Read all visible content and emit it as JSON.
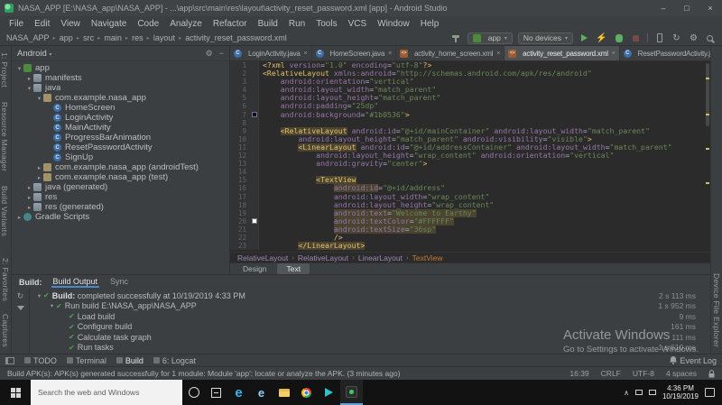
{
  "window": {
    "title": "NASA_APP [E:\\NASA_app\\NASA_APP] - ...\\app\\src\\main\\res\\layout\\activity_reset_password.xml [app] - Android Studio",
    "controls": {
      "minimize": "–",
      "maximize": "□",
      "close": "×"
    }
  },
  "menu": {
    "items": [
      "File",
      "Edit",
      "View",
      "Navigate",
      "Code",
      "Analyze",
      "Refactor",
      "Build",
      "Run",
      "Tools",
      "VCS",
      "Window",
      "Help"
    ]
  },
  "toolbar": {
    "path": [
      "NASA_APP",
      "app",
      "src",
      "main",
      "res",
      "layout",
      "activity_reset_password.xml"
    ],
    "run_config": "app",
    "device": "No devices"
  },
  "stripes": {
    "left_top": [
      "1: Project",
      "Resource Manager",
      "Build Variants"
    ],
    "left_bottom": [
      "2: Favorites",
      "Captures"
    ],
    "right_bottom": [
      "Device File Explorer"
    ]
  },
  "project": {
    "header": "Android",
    "tree": [
      {
        "label": "app",
        "depth": 0,
        "icon": "app",
        "arrow": "▾"
      },
      {
        "label": "manifests",
        "depth": 1,
        "icon": "folder",
        "arrow": "▸"
      },
      {
        "label": "java",
        "depth": 1,
        "icon": "folder",
        "arrow": "▾"
      },
      {
        "label": "com.example.nasa_app",
        "depth": 2,
        "icon": "package",
        "arrow": "▾"
      },
      {
        "label": "HomeScreen",
        "depth": 3,
        "icon": "class",
        "arrow": ""
      },
      {
        "label": "LoginActivity",
        "depth": 3,
        "icon": "class",
        "arrow": ""
      },
      {
        "label": "MainActivity",
        "depth": 3,
        "icon": "class",
        "arrow": ""
      },
      {
        "label": "ProgressBarAnimation",
        "depth": 3,
        "icon": "class",
        "arrow": ""
      },
      {
        "label": "ResetPasswordActivity",
        "depth": 3,
        "icon": "class",
        "arrow": ""
      },
      {
        "label": "SignUp",
        "depth": 3,
        "icon": "class",
        "arrow": ""
      },
      {
        "label": "com.example.nasa_app (androidTest)",
        "depth": 2,
        "icon": "package",
        "arrow": "▸"
      },
      {
        "label": "com.example.nasa_app (test)",
        "depth": 2,
        "icon": "package",
        "arrow": "▸"
      },
      {
        "label": "java (generated)",
        "depth": 1,
        "icon": "folder",
        "arrow": "▸"
      },
      {
        "label": "res",
        "depth": 1,
        "icon": "folder",
        "arrow": "▸"
      },
      {
        "label": "res (generated)",
        "depth": 1,
        "icon": "folder",
        "arrow": "▸"
      },
      {
        "label": "Gradle Scripts",
        "depth": 0,
        "icon": "gradle",
        "arrow": "▸"
      }
    ]
  },
  "editor": {
    "tabs": [
      {
        "label": "LoginActivity.java",
        "icon": "java",
        "selected": false
      },
      {
        "label": "HomeScreen.java",
        "icon": "java",
        "selected": false
      },
      {
        "label": "activity_home_screen.xml",
        "icon": "xml",
        "selected": false
      },
      {
        "label": "activity_reset_password.xml",
        "icon": "xml",
        "selected": true
      },
      {
        "label": "ResetPasswordActivity.java",
        "icon": "java",
        "selected": false
      }
    ],
    "breadcrumb": [
      "RelativeLayout",
      "RelativeLayout",
      "LinearLayout",
      "TextView"
    ],
    "view_tabs": [
      {
        "label": "Design",
        "selected": false
      },
      {
        "label": "Text",
        "selected": true
      }
    ],
    "code": [
      {
        "n": 1,
        "s": [
          [
            "<?xml ",
            "t"
          ],
          [
            "version",
            "a"
          ],
          [
            "=",
            "p"
          ],
          [
            "\"1.0\"",
            "v"
          ],
          [
            " ",
            "p"
          ],
          [
            "encoding",
            "a"
          ],
          [
            "=",
            "p"
          ],
          [
            "\"utf-8\"",
            "v"
          ],
          [
            "?>",
            "t"
          ]
        ]
      },
      {
        "n": 2,
        "s": [
          [
            "<RelativeLayout ",
            "t"
          ],
          [
            "xmlns:android",
            "a"
          ],
          [
            "=",
            "p"
          ],
          [
            "\"http://schemas.android.com/apk/res/android\"",
            "v"
          ]
        ]
      },
      {
        "n": 3,
        "s": [
          [
            "    ",
            "p"
          ],
          [
            "android:orientation",
            "a"
          ],
          [
            "=",
            "p"
          ],
          [
            "\"vertical\"",
            "v"
          ]
        ]
      },
      {
        "n": 4,
        "s": [
          [
            "    ",
            "p"
          ],
          [
            "android:layout_width",
            "a"
          ],
          [
            "=",
            "p"
          ],
          [
            "\"match_parent\"",
            "v"
          ]
        ]
      },
      {
        "n": 5,
        "s": [
          [
            "    ",
            "p"
          ],
          [
            "android:layout_height",
            "a"
          ],
          [
            "=",
            "p"
          ],
          [
            "\"match_parent\"",
            "v"
          ]
        ]
      },
      {
        "n": 6,
        "s": [
          [
            "    ",
            "p"
          ],
          [
            "android:padding",
            "a"
          ],
          [
            "=",
            "p"
          ],
          [
            "\"25dp\"",
            "v"
          ]
        ]
      },
      {
        "n": 7,
        "sw": "#1b0536",
        "s": [
          [
            "    ",
            "p"
          ],
          [
            "android:background",
            "a"
          ],
          [
            "=",
            "p"
          ],
          [
            "\"#1b0536\"",
            "v"
          ],
          [
            ">",
            "t"
          ]
        ]
      },
      {
        "n": 8,
        "s": []
      },
      {
        "n": 9,
        "s": [
          [
            "    ",
            "p"
          ],
          [
            "<RelativeLayout",
            "t",
            1
          ],
          [
            " ",
            "p"
          ],
          [
            "android:id",
            "a"
          ],
          [
            "=",
            "p"
          ],
          [
            "\"@+id/mainContainer\"",
            "v"
          ],
          [
            " ",
            "p"
          ],
          [
            "android:layout_width",
            "a"
          ],
          [
            "=",
            "p"
          ],
          [
            "\"match_parent\"",
            "v"
          ]
        ]
      },
      {
        "n": 10,
        "s": [
          [
            "        ",
            "p"
          ],
          [
            "android:layout_height",
            "a"
          ],
          [
            "=",
            "p"
          ],
          [
            "\"match_parent\"",
            "v"
          ],
          [
            " ",
            "p"
          ],
          [
            "android:visibility",
            "a"
          ],
          [
            "=",
            "p"
          ],
          [
            "\"visible\"",
            "v"
          ],
          [
            ">",
            "t"
          ]
        ]
      },
      {
        "n": 11,
        "s": [
          [
            "        ",
            "p"
          ],
          [
            "<LinearLayout",
            "t",
            1
          ],
          [
            " ",
            "p"
          ],
          [
            "android:id",
            "a"
          ],
          [
            "=",
            "p"
          ],
          [
            "\"@+id/addressContainer\"",
            "v"
          ],
          [
            " ",
            "p"
          ],
          [
            "android:layout_width",
            "a"
          ],
          [
            "=",
            "p"
          ],
          [
            "\"match_parent\"",
            "v"
          ]
        ]
      },
      {
        "n": 12,
        "s": [
          [
            "            ",
            "p"
          ],
          [
            "android:layout_height",
            "a"
          ],
          [
            "=",
            "p"
          ],
          [
            "\"wrap_content\"",
            "v"
          ],
          [
            " ",
            "p"
          ],
          [
            "android:orientation",
            "a"
          ],
          [
            "=",
            "p"
          ],
          [
            "\"vertical\"",
            "v"
          ]
        ]
      },
      {
        "n": 13,
        "s": [
          [
            "            ",
            "p"
          ],
          [
            "android:gravity",
            "a"
          ],
          [
            "=",
            "p"
          ],
          [
            "\"center\"",
            "v"
          ],
          [
            ">",
            "t"
          ]
        ]
      },
      {
        "n": 14,
        "s": []
      },
      {
        "n": 15,
        "s": [
          [
            "            ",
            "p"
          ],
          [
            "<TextView",
            "t",
            1
          ]
        ]
      },
      {
        "n": 16,
        "s": [
          [
            "                ",
            "p"
          ],
          [
            "android:id",
            "a",
            1
          ],
          [
            "=",
            "p"
          ],
          [
            "\"@+id/address\"",
            "v"
          ]
        ]
      },
      {
        "n": 17,
        "s": [
          [
            "                ",
            "p"
          ],
          [
            "android:layout_width",
            "a"
          ],
          [
            "=",
            "p"
          ],
          [
            "\"wrap_content\"",
            "v"
          ]
        ]
      },
      {
        "n": 18,
        "s": [
          [
            "                ",
            "p"
          ],
          [
            "android:layout_height",
            "a"
          ],
          [
            "=",
            "p"
          ],
          [
            "\"wrap_content\"",
            "v"
          ]
        ]
      },
      {
        "n": 19,
        "s": [
          [
            "                ",
            "p"
          ],
          [
            "android:text",
            "a",
            1
          ],
          [
            "=",
            "p",
            1
          ],
          [
            "\"Welcome to Earthy\"",
            "v",
            1
          ]
        ]
      },
      {
        "n": 20,
        "sw": "#FFFFFF",
        "s": [
          [
            "                ",
            "p"
          ],
          [
            "android:textColor",
            "a",
            1
          ],
          [
            "=",
            "p",
            1
          ],
          [
            "\"#FFFFFF\"",
            "v",
            1
          ]
        ]
      },
      {
        "n": 21,
        "s": [
          [
            "                ",
            "p"
          ],
          [
            "android:textSize",
            "a",
            1
          ],
          [
            "=",
            "p",
            1
          ],
          [
            "\"36sp\"",
            "v",
            1
          ]
        ]
      },
      {
        "n": 22,
        "s": [
          [
            "                ",
            "p"
          ],
          [
            "/>",
            "t"
          ]
        ]
      },
      {
        "n": 23,
        "s": [
          [
            "        ",
            "p"
          ],
          [
            "</LinearLayout>",
            "t",
            1
          ]
        ]
      }
    ]
  },
  "build": {
    "panel_label": "Build:",
    "tabs": [
      {
        "label": "Build Output",
        "selected": true
      },
      {
        "label": "Sync",
        "selected": false
      }
    ],
    "tree": [
      {
        "depth": 0,
        "arrow": "▾",
        "prefix": "Build:",
        "label": "completed successfully at 10/19/2019 4:33 PM",
        "time": "2 s 113 ms"
      },
      {
        "depth": 1,
        "arrow": "▾",
        "prefix": "",
        "label": "Run build E:\\NASA_app\\NASA_APP",
        "time": "1 s 952 ms"
      },
      {
        "depth": 2,
        "arrow": "",
        "prefix": "",
        "label": "Load build",
        "time": "9 ms"
      },
      {
        "depth": 2,
        "arrow": "",
        "prefix": "",
        "label": "Configure build",
        "time": "161 ms"
      },
      {
        "depth": 2,
        "arrow": "",
        "prefix": "",
        "label": "Calculate task graph",
        "time": "111 ms"
      },
      {
        "depth": 2,
        "arrow": "",
        "prefix": "",
        "label": "Run tasks",
        "time": "1 s 610 ms"
      }
    ]
  },
  "bottom_bar": {
    "left": [
      "TODO",
      "Terminal",
      "Build",
      "6: Logcat"
    ],
    "active": "Build",
    "event_log": "Event Log"
  },
  "status_bar": {
    "message": "Build APK(s): APK(s) generated successfully for 1 module: Module 'app': locate or analyze the APK. (3 minutes ago)",
    "caret": "16:39",
    "line_sep": "CRLF",
    "encoding": "UTF-8",
    "indent": "4 spaces"
  },
  "watermark": {
    "line1": "Activate Windows",
    "line2": "Go to Settings to activate Windows."
  },
  "taskbar": {
    "search_placeholder": "Search the web and Windows",
    "icons": [
      "cortana-icon",
      "task-view-icon",
      "edge-icon",
      "ie-icon",
      "explorer-icon",
      "chrome-icon",
      "play-icon",
      "android-studio-icon"
    ],
    "time": "4:36 PM",
    "date": "10/19/2019"
  }
}
